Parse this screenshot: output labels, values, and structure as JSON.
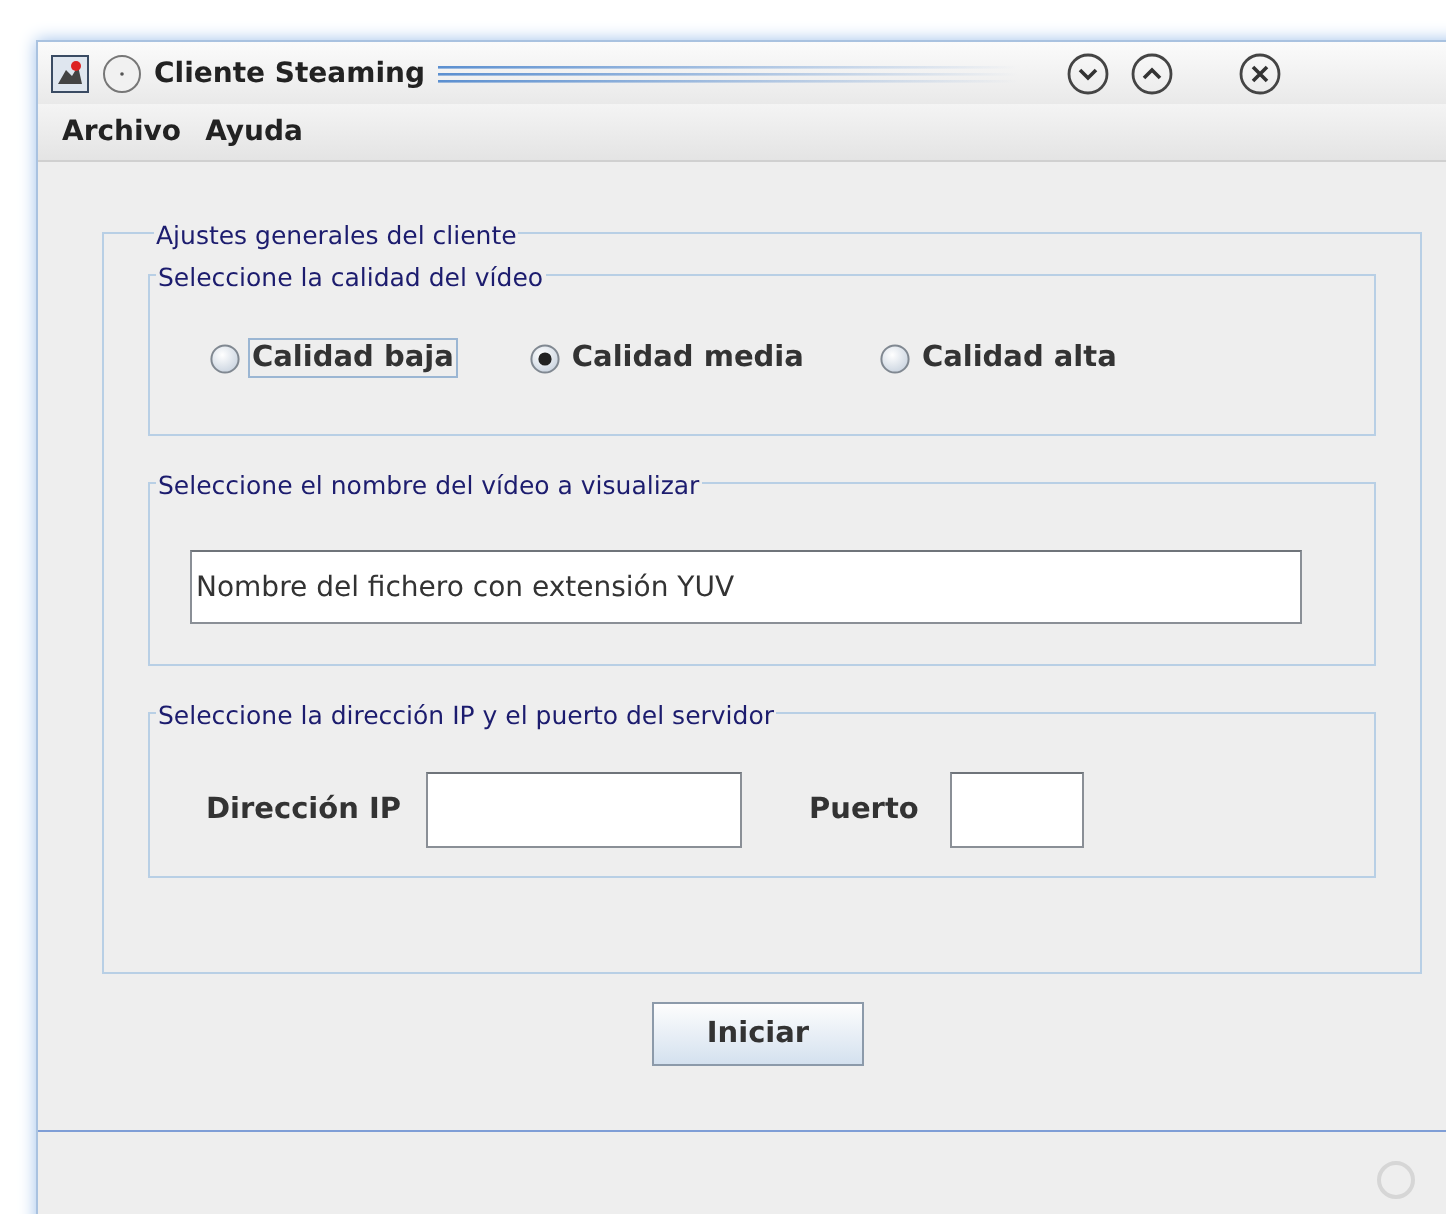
{
  "window": {
    "title": "Cliente Steaming"
  },
  "menu": [
    "Archivo",
    "Ayuda"
  ],
  "panel": {
    "title": "Ajustes generales del cliente",
    "quality": {
      "title": "Seleccione la calidad del vídeo",
      "options": [
        {
          "label": "Calidad baja",
          "selected": false,
          "focused": true
        },
        {
          "label": "Calidad media",
          "selected": true,
          "focused": false
        },
        {
          "label": "Calidad alta",
          "selected": false,
          "focused": false
        }
      ]
    },
    "video": {
      "title": "Seleccione el nombre del vídeo a visualizar",
      "value": "Nombre del fichero con extensión YUV"
    },
    "server": {
      "title": "Seleccione la dirección IP y el puerto del servidor",
      "ip_label": "Dirección IP",
      "port_label": "Puerto"
    }
  },
  "button": "Iniciar"
}
